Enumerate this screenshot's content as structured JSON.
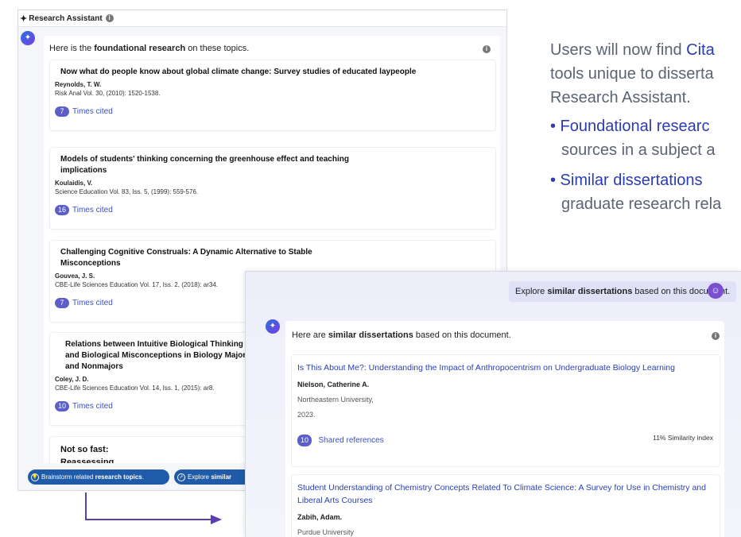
{
  "left_panel": {
    "header_title": "Research Assistant",
    "info_symbol": "i",
    "ai_symbol": "✦",
    "intro_prefix": "Here is the ",
    "intro_bold": "foundational research",
    "intro_suffix": " on these topics.",
    "references": [
      {
        "title": "Now what do people know about global climate change: Survey studies of educated laypeople",
        "author": "Reynolds, T. W.",
        "source": "Risk Anal Vol. 30, (2010): 1520-1538.",
        "cited_count": "7",
        "cited_label": "Times cited"
      },
      {
        "title": "Models of students' thinking concerning the greenhouse effect and teaching implications",
        "author": "Koulaidis, V.",
        "source": "Science Education Vol. 83, Iss. 5, (1999): 559-576.",
        "cited_count": "16",
        "cited_label": "Times cited"
      },
      {
        "title": "Challenging Cognitive Construals: A Dynamic Alternative to Stable Misconceptions",
        "author": "Gouvea, J. S.",
        "source": "CBE-Life Sciences Education Vol. 17, Iss. 2, (2018): ar34.",
        "cited_count": "7",
        "cited_label": "Times cited"
      },
      {
        "title": "Relations between Intuitive Biological Thinking and Biological Misconceptions in Biology Majors and Nonmajors",
        "author": "Coley, J. D.",
        "source": "CBE-Life Sciences Education Vol. 14, Iss. 1, (2015): ar8.",
        "cited_count": "10",
        "cited_label": "Times cited"
      },
      {
        "title": "Not so fast: Reassessing gender",
        "author": "",
        "source": "",
        "cited_count": "",
        "cited_label": ""
      }
    ],
    "buttons": {
      "brainstorm_prefix": "Brainstorm related ",
      "brainstorm_bold": "research topics",
      "brainstorm_suffix": ".",
      "explore_prefix": "Explore ",
      "explore_bold": "similar"
    }
  },
  "marketing": {
    "line1_prefix": "Users will now find ",
    "line1_bold": "Cita",
    "line2": "tools unique to disserta",
    "line3": "Research Assistant.",
    "bullets": [
      {
        "bold": "• Foundational researc",
        "sub": "sources in a subject a"
      },
      {
        "bold": "• Similar dissertations",
        "sub": "graduate research rela"
      }
    ]
  },
  "front_panel": {
    "user_msg_prefix": "Explore ",
    "user_msg_bold": "similar dissertations",
    "user_msg_suffix": " based on this document.",
    "user_symbol": "☺",
    "ai_symbol": "✦",
    "info_symbol": "i",
    "intro_prefix": "Here are ",
    "intro_bold": "similar dissertations",
    "intro_suffix": " based on this document.",
    "dissertations": [
      {
        "title": "Is This About Me?: Understanding the Impact of Anthropocentrism on Undergraduate Biology Learning",
        "author": "Nielson, Catherine A.",
        "institution": "Northeastern University,",
        "year": "2023.",
        "shared_count": "10",
        "shared_label": "Shared references",
        "similarity": "11% Similarity index"
      },
      {
        "title": "Student Understanding of Chemistry Concepts Related To Climate Science: A Survey for Use in Chemistry and Liberal Arts Courses",
        "author": "Zabih, Adam.",
        "institution": "Purdue University"
      }
    ]
  },
  "colors": {
    "accent": "#2b3bb0",
    "badge": "#5b5fc7",
    "button": "#1f5ba8",
    "arrow": "#5a3db3"
  }
}
